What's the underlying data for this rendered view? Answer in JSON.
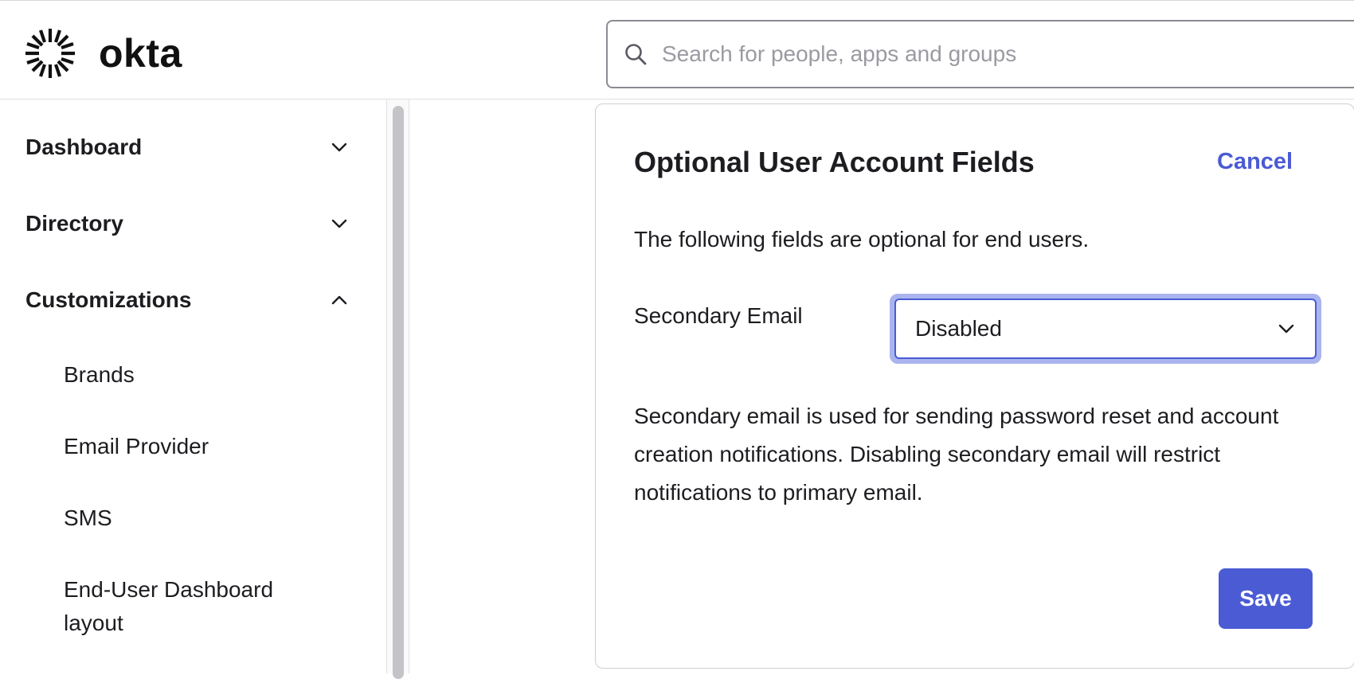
{
  "app": {
    "brand_name": "okta"
  },
  "search": {
    "placeholder": "Search for people, apps and groups",
    "value": ""
  },
  "sidebar": {
    "items": [
      {
        "label": "Dashboard",
        "expanded": false
      },
      {
        "label": "Directory",
        "expanded": false
      },
      {
        "label": "Customizations",
        "expanded": true
      }
    ],
    "sub_items": [
      "Brands",
      "Email Provider",
      "SMS",
      "End-User Dashboard layout"
    ]
  },
  "panel": {
    "title": "Optional User Account Fields",
    "cancel_label": "Cancel",
    "intro": "The following fields are optional for end users.",
    "field_label": "Secondary Email",
    "field_value": "Disabled",
    "description": "Secondary email is used for sending password reset and account creation notifications. Disabling secondary email will restrict notifications to primary email.",
    "save_label": "Save"
  },
  "colors": {
    "accent": "#4a5bd4",
    "focus_ring": "#aab4ef",
    "text": "#1d1d21",
    "placeholder": "#9a9aa2"
  },
  "icons": {
    "search": "search-icon",
    "logo": "okta-sunburst-logo",
    "collapsed": "chevron-down-icon",
    "expanded": "chevron-up-icon",
    "select": "chevron-down-icon"
  }
}
